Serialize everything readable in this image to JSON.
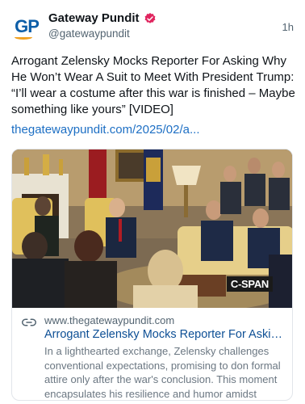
{
  "author": {
    "display_name": "Gateway Pundit",
    "handle": "@gatewaypundit",
    "avatar_text": "GP",
    "verified_color": "#e0245e"
  },
  "timestamp": "1h",
  "post": {
    "text": "Arrogant Zelensky Mocks Reporter For Asking Why He Won’t Wear A Suit to Meet With President Trump: “I’ll wear a costume after this war is finished – Maybe something like yours” [VIDEO]",
    "link_text": "thegatewaypundit.com/2025/02/a..."
  },
  "link_card": {
    "image_badge": "C-SPAN",
    "link_icon": "link-icon",
    "domain": "www.thegatewaypundit.com",
    "title": "Arrogant Zelensky Mocks Reporter For Asking ...",
    "description": "In a lighthearted exchange, Zelensky challenges conventional expectations, promising to don formal attire only after the war's conclusion. This moment encapsulates his resilience and humor amidst adversi..."
  },
  "colors": {
    "link": "#1d6fc4",
    "card_title": "#0d4f95",
    "secondary_text": "#536471"
  }
}
